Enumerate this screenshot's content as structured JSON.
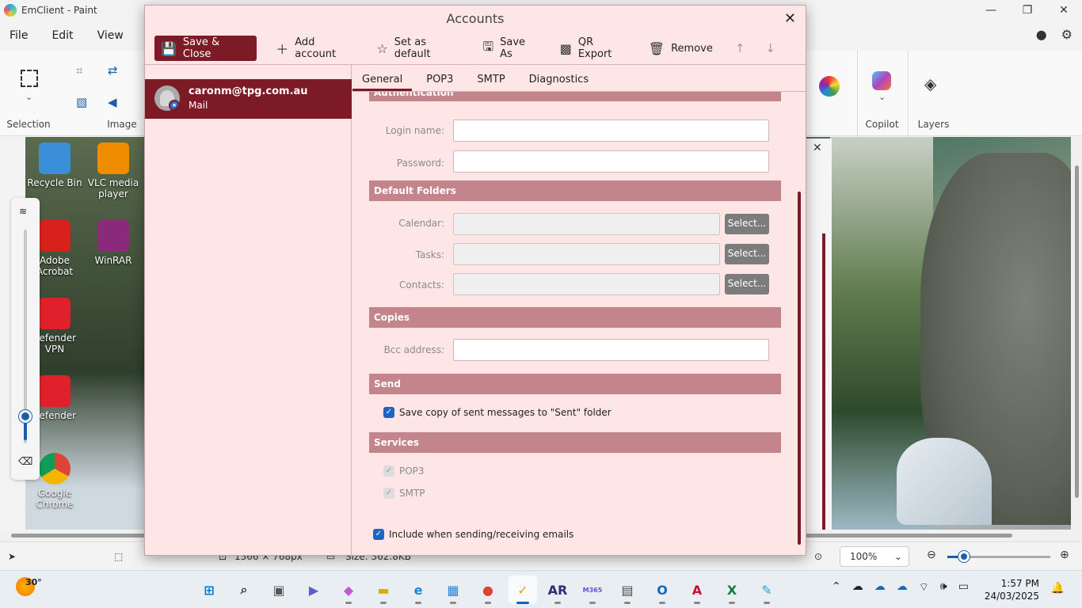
{
  "paint": {
    "title": "EmClient - Paint",
    "menu": [
      "File",
      "Edit",
      "View"
    ],
    "ribbon": {
      "selection_label": "Selection",
      "image_label": "Image",
      "copilot_label": "Copilot",
      "layers_label": "Layers"
    },
    "status": {
      "dimensions": "1366 × 768px",
      "size": "Size: 362.8KB",
      "zoom": "100%"
    }
  },
  "desktop_icons": [
    {
      "label": "Recycle Bin",
      "color": "#3b8fd8"
    },
    {
      "label": "VLC media player",
      "color": "#f08c00"
    },
    {
      "label": "Adobe Acrobat",
      "color": "#d8201c"
    },
    {
      "label": "WinRAR",
      "color": "#8a2a7a"
    },
    {
      "label": "defender VPN",
      "color": "#e0202a"
    },
    {
      "label": "defender",
      "color": "#e0202a"
    },
    {
      "label": "Google Chrome",
      "color": "#34a853"
    }
  ],
  "taskbar": {
    "weather_temp": "30°",
    "time": "1:57 PM",
    "date": "24/03/2025",
    "apps": [
      {
        "name": "start",
        "label": "⊞",
        "color": "#0078d4"
      },
      {
        "name": "search",
        "label": "⌕",
        "color": "#333333"
      },
      {
        "name": "task-view",
        "label": "▣",
        "color": "#555555"
      },
      {
        "name": "teams",
        "label": "▶",
        "color": "#5b5fc7"
      },
      {
        "name": "copilot",
        "label": "◆",
        "color": "#c05ad8"
      },
      {
        "name": "file-explorer",
        "label": "▬",
        "color": "#e8a800"
      },
      {
        "name": "edge",
        "label": "e",
        "color": "#1f86d0"
      },
      {
        "name": "store",
        "label": "▦",
        "color": "#2a7fd4"
      },
      {
        "name": "chrome",
        "label": "●",
        "color": "#db4437"
      },
      {
        "name": "emclient",
        "label": "✓",
        "color": "#e8a000"
      },
      {
        "name": "ar",
        "label": "AR",
        "color": "#2e2e6e"
      },
      {
        "name": "m365",
        "label": "M365",
        "color": "#6f4bd8"
      },
      {
        "name": "calculator",
        "label": "▤",
        "color": "#4a4a4a"
      },
      {
        "name": "outlook",
        "label": "O",
        "color": "#0f6cbd"
      },
      {
        "name": "acrobat",
        "label": "A",
        "color": "#c8102e"
      },
      {
        "name": "excel",
        "label": "X",
        "color": "#107c41"
      },
      {
        "name": "paint",
        "label": "✎",
        "color": "#2aa0d8"
      }
    ]
  },
  "dialog": {
    "title": "Accounts",
    "toolbar": {
      "save_close": "Save & Close",
      "add_account": "Add account",
      "set_default": "Set as default",
      "save_as": "Save As",
      "qr_export": "QR Export",
      "remove": "Remove"
    },
    "account": {
      "email": "caronm@tpg.com.au",
      "type": "Mail"
    },
    "tabs": [
      "General",
      "POP3",
      "SMTP",
      "Diagnostics"
    ],
    "sections": {
      "authentication": "Authentication",
      "default_folders": "Default Folders",
      "copies": "Copies",
      "send": "Send",
      "services": "Services"
    },
    "fields": {
      "login_name": "Login name:",
      "password": "Password:",
      "calendar": "Calendar:",
      "tasks": "Tasks:",
      "contacts": "Contacts:",
      "bcc": "Bcc address:"
    },
    "select_label": "Select...",
    "checks": {
      "save_sent": "Save copy of sent messages to \"Sent\" folder",
      "pop3": "POP3",
      "smtp": "SMTP",
      "include": "Include when sending/receiving emails"
    }
  }
}
